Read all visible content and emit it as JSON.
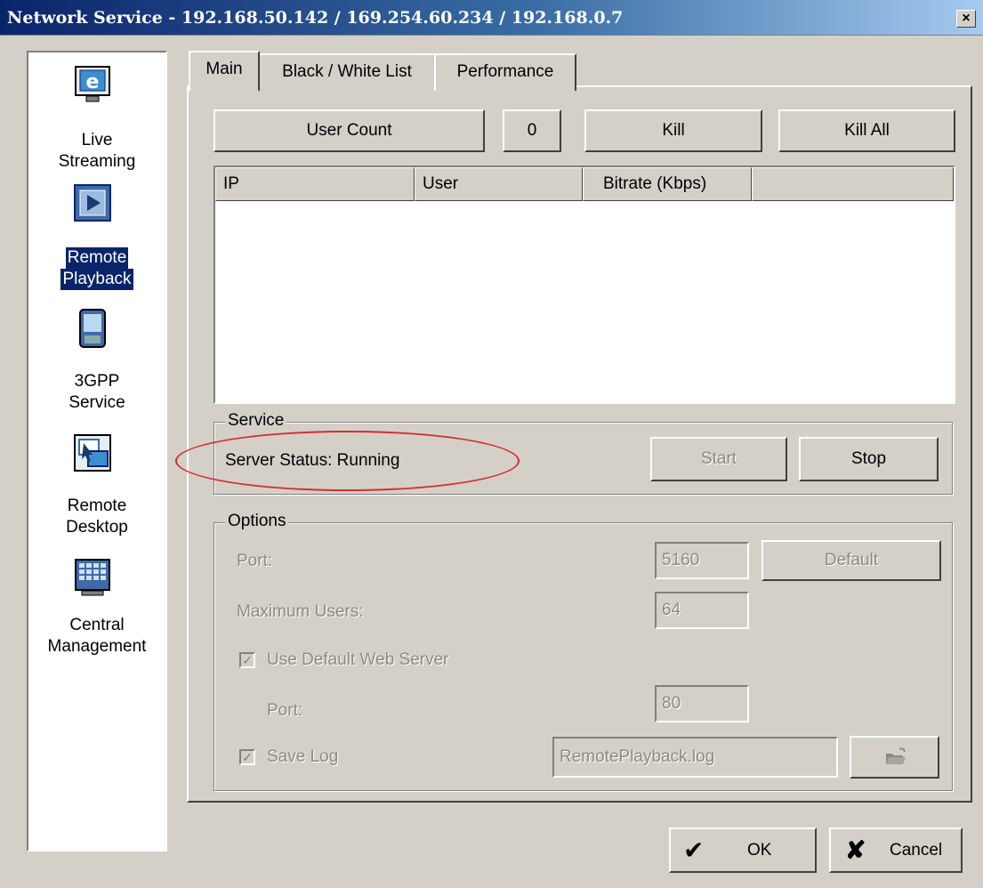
{
  "window": {
    "title": "Network Service - 192.168.50.142 / 169.254.60.234 / 192.168.0.7",
    "close_glyph": "×"
  },
  "sidebar": {
    "items": [
      {
        "line1": "Live",
        "line2": "Streaming",
        "icon": "live-streaming-icon",
        "selected": false
      },
      {
        "line1": "Remote",
        "line2": "Playback",
        "icon": "remote-playback-icon",
        "selected": true
      },
      {
        "line1": "3GPP",
        "line2": "Service",
        "icon": "3gpp-service-icon",
        "selected": false
      },
      {
        "line1": "Remote",
        "line2": "Desktop",
        "icon": "remote-desktop-icon",
        "selected": false
      },
      {
        "line1": "Central",
        "line2": "Management",
        "icon": "central-management-icon",
        "selected": false
      }
    ]
  },
  "tabs": [
    {
      "label": "Main",
      "active": true
    },
    {
      "label": "Black / White List",
      "active": false
    },
    {
      "label": "Performance",
      "active": false
    }
  ],
  "main": {
    "user_count_label": "User Count",
    "user_count_value": "0",
    "kill_label": "Kill",
    "kill_all_label": "Kill All",
    "columns": [
      "IP",
      "User",
      "Bitrate (Kbps)"
    ],
    "rows": []
  },
  "service": {
    "group_label": "Service",
    "status_text": "Server Status: Running",
    "start_label": "Start",
    "stop_label": "Stop",
    "highlight_color": "#d32f2f"
  },
  "options": {
    "group_label": "Options",
    "port_label": "Port:",
    "port_value": "5160",
    "default_label": "Default",
    "max_users_label": "Maximum Users:",
    "max_users_value": "64",
    "use_default_web_server_label": "Use Default Web Server",
    "use_default_web_server_checked": true,
    "web_port_label": "Port:",
    "web_port_value": "80",
    "save_log_label": "Save Log",
    "save_log_checked": true,
    "log_file_value": "RemotePlayback.log",
    "browse_icon": "folder-open-icon"
  },
  "footer": {
    "ok_label": "OK",
    "cancel_label": "Cancel"
  }
}
